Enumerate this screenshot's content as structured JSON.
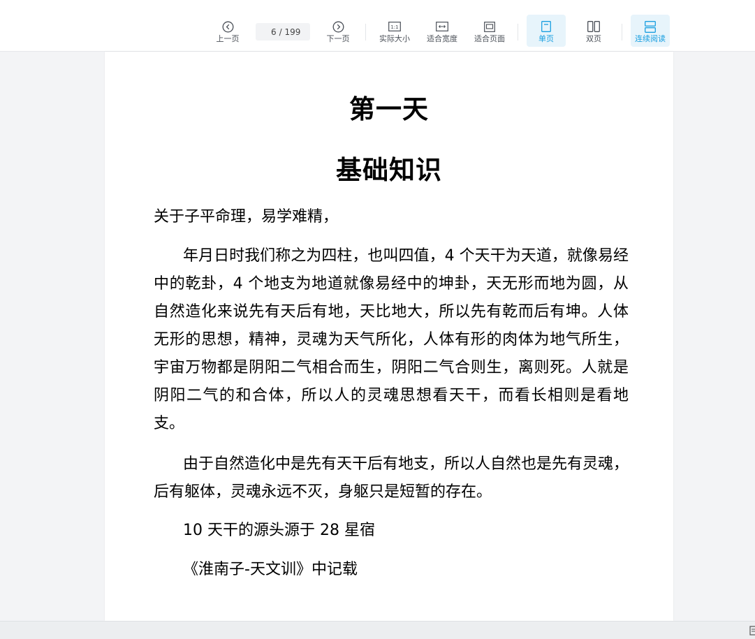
{
  "toolbar": {
    "prev_page": "上一页",
    "current_page": "6",
    "total_pages": "/ 199",
    "next_page": "下一页",
    "actual_size": "实际大小",
    "actual_size_glyph": "1:1",
    "fit_width": "适合宽度",
    "fit_page": "适合页面",
    "single_page": "单页",
    "double_page": "双页",
    "continuous": "连续阅读",
    "accent_color": "#1a9fe0"
  },
  "document": {
    "heading1": "第一天",
    "heading2": "基础知识",
    "paragraphs": [
      "关于子平命理，易学难精，",
      "年月日时我们称之为四柱，也叫四值，4 个天干为天道，就像易经中的乾卦，4 个地支为地道就像易经中的坤卦，天无形而地为圆，从自然造化来说先有天后有地，天比地大，所以先有乾而后有坤。人体无形的思想，精神，灵魂为天气所化，人体有形的肉体为地气所生，宇宙万物都是阴阳二气相合而生，阴阳二气合则生，离则死。人就是阴阳二气的和合体，所以人的灵魂思想看天干，而看长相则是看地支。",
      "由于自然造化中是先有天干后有地支，所以人自然也是先有灵魂，后有躯体，灵魂永远不灭，身躯只是短暂的存在。",
      "10 天干的源头源于 28 星宿",
      "《淮南子-天文训》中记载"
    ]
  }
}
